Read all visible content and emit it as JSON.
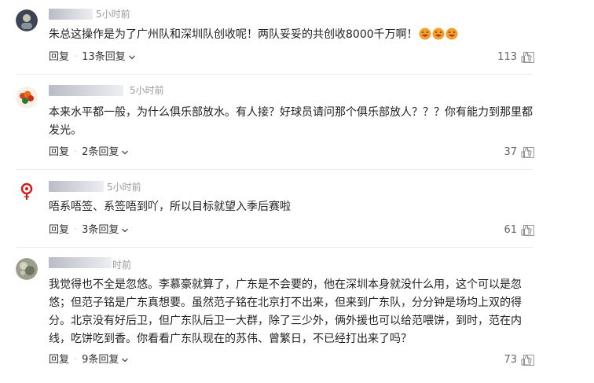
{
  "comments": [
    {
      "username": "",
      "time": "5小时前",
      "content": "朱总这操作是为了广州队和深圳队创收呢！两队妥妥的共创收8000千万啊！",
      "emoji_count": 3,
      "reply_label": "回复",
      "replies_label": "13条回复",
      "likes": "113"
    },
    {
      "username": "",
      "time": "5小时前",
      "content": "本来水平都一般，为什么俱乐部放水。有人接？好球员请问那个俱乐部放人？？？你有能力到那里都发光。",
      "reply_label": "回复",
      "replies_label": "2条回复",
      "likes": "37"
    },
    {
      "username": "",
      "time": "5小时前",
      "content": "唔系唔签、系签唔到吖，所以目标就望入季后赛啦",
      "reply_label": "回复",
      "replies_label": "3条回复",
      "likes": "61"
    },
    {
      "username": "",
      "time": "时前",
      "content": "我觉得也不全是忽悠。李慕豪就算了，广东是不会要的，他在深圳本身就没什么用，这个可以是忽悠；但范子铭是广东真想要。虽然范子铭在北京打不出来，但来到广东队，分分钟是场均上双的得分。北京没有好后卫，但广东队后卫一大群，除了三少外，俩外援也可以给范喂饼，到时，范在内线，吃饼吃到香。你看看广东队现在的苏伟、曾繁日，不已经打出来了吗？",
      "reply_label": "回复",
      "replies_label": "9条回复",
      "likes": "73"
    }
  ],
  "icons": {
    "like": "thumbs-up-icon",
    "report": "report-icon",
    "expand": "chevron-down-icon",
    "emoji": "laughing-face-emoji"
  },
  "colors": {
    "text": "#222222",
    "meta": "#999999",
    "divider": "#eeeeee"
  }
}
